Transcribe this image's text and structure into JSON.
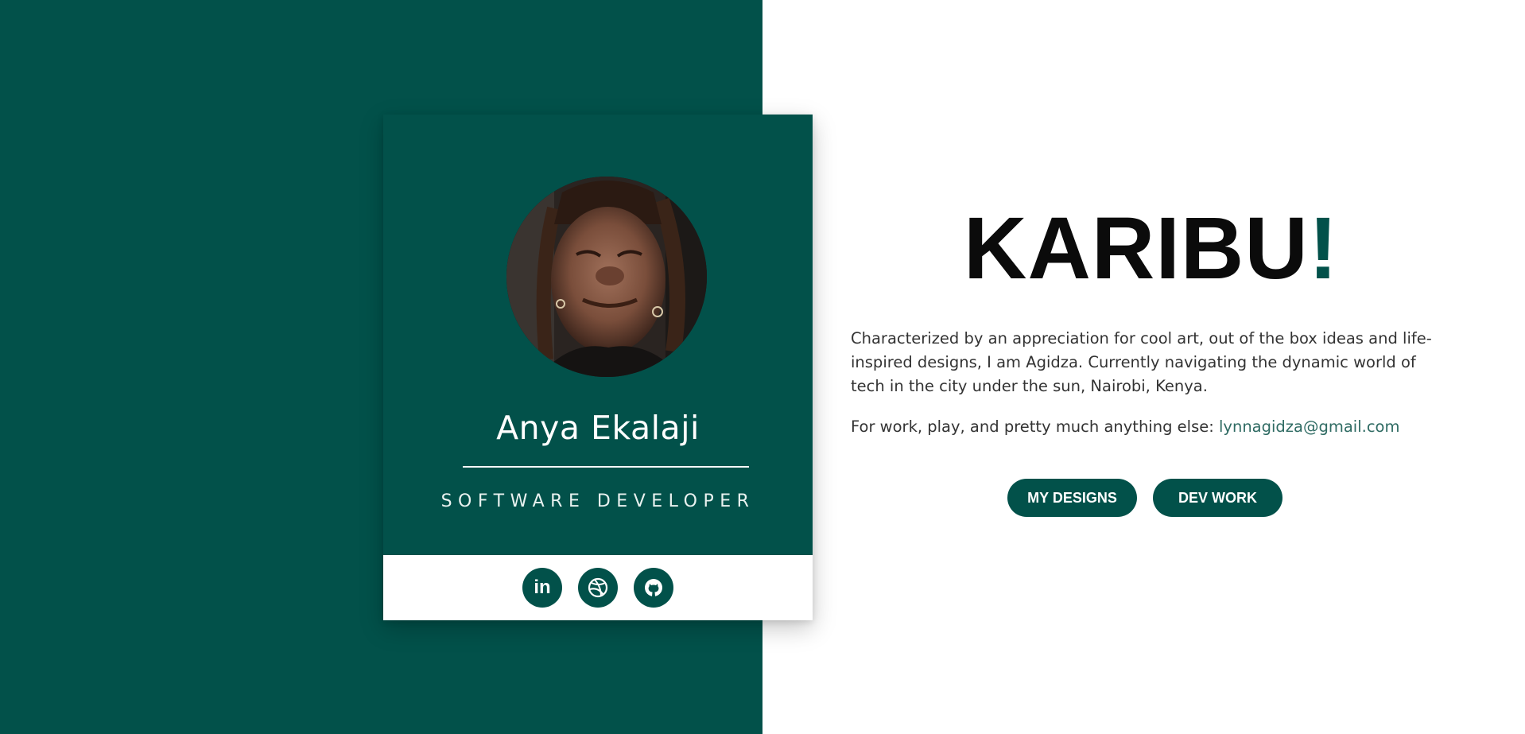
{
  "profile": {
    "name": "Anya Ekalaji",
    "role": "SOFTWARE DEVELOPER",
    "avatar_alt": "profile photo"
  },
  "social": [
    {
      "name": "linkedin",
      "glyph": "in",
      "icon": "linkedin-icon"
    },
    {
      "name": "dribbble",
      "icon": "dribbble-icon"
    },
    {
      "name": "github",
      "icon": "github-icon"
    }
  ],
  "hero": {
    "headline": "KARIBU",
    "exclamation": "!",
    "bio": "Characterized by an appreciation for cool art, out of the box ideas and life-inspired designs, I am Agidza. Currently navigating the dynamic world of tech in the city under the sun, Nairobi, Kenya.",
    "contact_prefix": "For work, play, and pretty much anything else: ",
    "email": "lynnagidza@gmail.com"
  },
  "buttons": {
    "designs": "MY DESIGNS",
    "dev": "DEV WORK"
  },
  "colors": {
    "primary": "#02514A",
    "background": "#ffffff",
    "text": "#333333",
    "link": "#2f6b63"
  }
}
